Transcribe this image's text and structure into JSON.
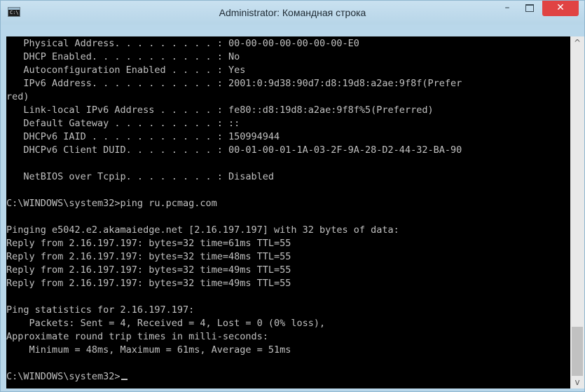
{
  "window": {
    "title": "Administrator: Командная строка",
    "icon_label": "C:\\",
    "minimize_glyph": "–",
    "close_glyph": "✕"
  },
  "console": {
    "lines": [
      "   Physical Address. . . . . . . . . : 00-00-00-00-00-00-00-E0",
      "   DHCP Enabled. . . . . . . . . . . : No",
      "   Autoconfiguration Enabled . . . . : Yes",
      "   IPv6 Address. . . . . . . . . . . : 2001:0:9d38:90d7:d8:19d8:a2ae:9f8f(Prefer",
      "red)",
      "   Link-local IPv6 Address . . . . . : fe80::d8:19d8:a2ae:9f8f%5(Preferred)",
      "   Default Gateway . . . . . . . . . : ::",
      "   DHCPv6 IAID . . . . . . . . . . . : 150994944",
      "   DHCPv6 Client DUID. . . . . . . . : 00-01-00-01-1A-03-2F-9A-28-D2-44-32-BA-90",
      "",
      "   NetBIOS over Tcpip. . . . . . . . : Disabled",
      "",
      "C:\\WINDOWS\\system32>ping ru.pcmag.com",
      "",
      "Pinging e5042.e2.akamaiedge.net [2.16.197.197] with 32 bytes of data:",
      "Reply from 2.16.197.197: bytes=32 time=61ms TTL=55",
      "Reply from 2.16.197.197: bytes=32 time=48ms TTL=55",
      "Reply from 2.16.197.197: bytes=32 time=49ms TTL=55",
      "Reply from 2.16.197.197: bytes=32 time=49ms TTL=55",
      "",
      "Ping statistics for 2.16.197.197:",
      "    Packets: Sent = 4, Received = 4, Lost = 0 (0% loss),",
      "Approximate round trip times in milli-seconds:",
      "    Minimum = 48ms, Maximum = 61ms, Average = 51ms",
      "",
      "C:\\WINDOWS\\system32>"
    ]
  },
  "scrollbar": {
    "up_glyph": "^",
    "down_glyph": "v",
    "position_fraction": 0.93
  },
  "colors": {
    "console_background": "#000000",
    "console_text": "#c0c0c0",
    "close_button": "#e04343",
    "title_bar": "#c3ddee"
  }
}
